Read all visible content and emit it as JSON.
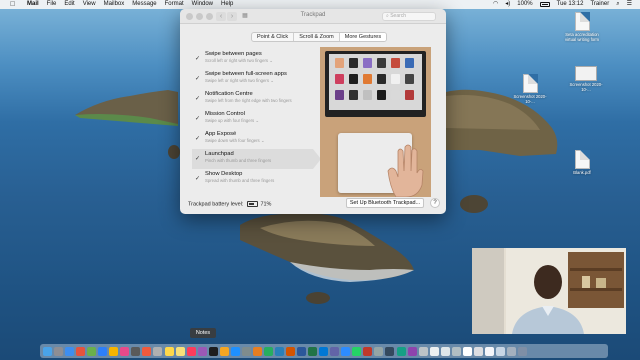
{
  "menubar": {
    "app_name": "Mail",
    "items": [
      "File",
      "Edit",
      "View",
      "Mailbox",
      "Message",
      "Format",
      "Window",
      "Help"
    ],
    "battery": "100%",
    "clock": "Tue 13:12",
    "user": "Trainer"
  },
  "window": {
    "title": "Trackpad",
    "search_placeholder": "Search",
    "tabs": [
      {
        "label": "Point & Click",
        "active": false
      },
      {
        "label": "Scroll & Zoom",
        "active": false
      },
      {
        "label": "More Gestures",
        "active": true
      }
    ],
    "gestures": [
      {
        "title": "Swipe between pages",
        "subtitle": "Scroll left or right with two fingers ⌄",
        "checked": true,
        "selected": false
      },
      {
        "title": "Swipe between full-screen apps",
        "subtitle": "Swipe left or right with two fingers ⌄",
        "checked": true,
        "selected": false
      },
      {
        "title": "Notification Centre",
        "subtitle": "Swipe left from the right edge with two fingers",
        "checked": true,
        "selected": false
      },
      {
        "title": "Mission Control",
        "subtitle": "Swipe up with four fingers ⌄",
        "checked": true,
        "selected": false
      },
      {
        "title": "App Exposé",
        "subtitle": "Swipe down with four fingers ⌄",
        "checked": true,
        "selected": false
      },
      {
        "title": "Launchpad",
        "subtitle": "Pinch with thumb and three fingers",
        "checked": true,
        "selected": true
      },
      {
        "title": "Show Desktop",
        "subtitle": "Spread with thumb and three fingers",
        "checked": true,
        "selected": false
      }
    ],
    "battery_label": "Trackpad battery level:",
    "battery_value": "71%",
    "setup_button": "Set Up Bluetooth Trackpad...",
    "help_button": "?"
  },
  "desktop_files": [
    {
      "name": "Seta accreditation virtual writing form"
    },
    {
      "name": "Screenshot 2020-10-..."
    },
    {
      "name": "Screenshot 2020-10-..."
    },
    {
      "name": "Blank.pdf"
    }
  ],
  "dock": {
    "tooltip": "Notes"
  },
  "colors": {
    "sea": "#2f6ea5",
    "sky": "#7fb6da",
    "window_bg": "#ececec",
    "selected_row": "#dcdcdc"
  }
}
